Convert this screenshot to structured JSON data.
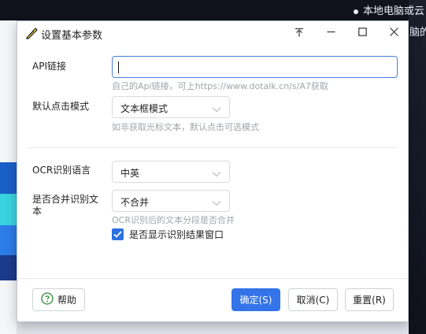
{
  "background": {
    "text_line_1": "本地电脑或云",
    "text_line_2": "脑的",
    "colors": {
      "dark": "#10131c",
      "accent_blue": "#1a5fc7",
      "accent_cyan": "#37d3de"
    }
  },
  "dialog": {
    "title": "设置基本参数",
    "window_controls": {
      "pin_icon": "pin-icon",
      "minimize_icon": "minimize-icon",
      "maximize_icon": "maximize-icon",
      "close_icon": "close-icon"
    }
  },
  "form": {
    "api": {
      "label": "API链接",
      "value": "",
      "hint": "自己的Api链接，可上https://www.dotalk.cn/s/A7获取"
    },
    "click_mode": {
      "label": "默认点击模式",
      "selected": "文本框模式",
      "hint": "如非获取光标文本，默认点击可选模式"
    },
    "ocr_language": {
      "label": "OCR识别语言",
      "selected": "中英"
    },
    "merge_text": {
      "label_line1": "是否合并识别文",
      "label_line2": "本",
      "selected": "不合并",
      "hint": "OCR识别后的文本分段是否合并"
    },
    "show_result": {
      "label": "是否显示识别结果窗口",
      "checked": true
    }
  },
  "buttons": {
    "help": "帮助",
    "ok": "确定(S)",
    "cancel": "取消(C)",
    "reset": "重置(R)"
  },
  "colors": {
    "primary": "#3474e8",
    "checkbox": "#2b72e0",
    "focus_border": "#4a7fe0",
    "hint_text": "#a0a4aa"
  }
}
